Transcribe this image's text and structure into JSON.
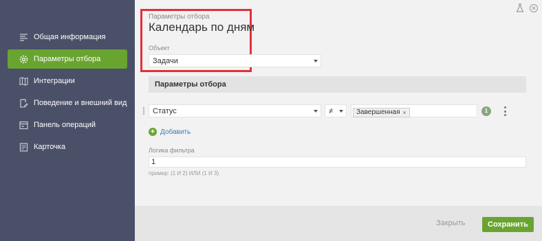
{
  "sidebar": {
    "items": [
      {
        "label": "Общая информация",
        "icon": "list-icon"
      },
      {
        "label": "Параметры отбора",
        "icon": "gear-icon",
        "active": true
      },
      {
        "label": "Интеграции",
        "icon": "map-icon"
      },
      {
        "label": "Поведение и внешний вид",
        "icon": "edit-icon"
      },
      {
        "label": "Панель операций",
        "icon": "toolbar-icon"
      },
      {
        "label": "Карточка",
        "icon": "card-icon"
      }
    ]
  },
  "header": {
    "subtitle": "Параметры отбора",
    "title": "Календарь по дням"
  },
  "object_field": {
    "label": "Объект",
    "value": "Задачи"
  },
  "filter_section": {
    "title": "Параметры отбора",
    "condition": {
      "field": "Статус",
      "operator": "≠",
      "tag": "Завершенная",
      "tag_remove": "×",
      "index": "1"
    },
    "add_label": "Добавить"
  },
  "logic": {
    "label": "Логика фильтра",
    "value": "1",
    "hint": "пример: (1 И 2) ИЛИ (1 И 3)"
  },
  "footer": {
    "close_label": "Закрыть",
    "save_label": "Сохранить"
  },
  "colors": {
    "sidebar_bg": "#4a5068",
    "accent": "#6aa430",
    "highlight": "#e32f3a",
    "link": "#3a7bbf"
  }
}
